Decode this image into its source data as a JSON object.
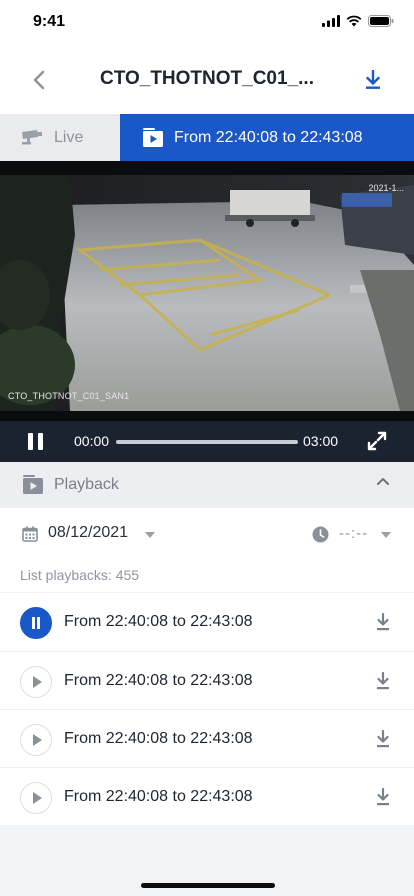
{
  "status_bar": {
    "time": "9:41"
  },
  "nav": {
    "title": "CTO_THOTNOT_C01_..."
  },
  "tabs": [
    {
      "label": "Live",
      "active": false
    },
    {
      "label": "From 22:40:08 to 22:43:08",
      "active": true
    }
  ],
  "video": {
    "camera_label": "CTO_THOTNOT_C01_SAN1",
    "timestamp_overlay": "2021-1..."
  },
  "player": {
    "current_time": "00:00",
    "duration": "03:00",
    "progress_fraction": 0.0,
    "state": "playing"
  },
  "playback_section": {
    "title": "Playback"
  },
  "filters": {
    "date": "08/12/2021",
    "time": "--:--"
  },
  "list_count_text": "List playbacks: 455",
  "playbacks": [
    {
      "label": "From 22:40:08 to 22:43:08",
      "playing": true
    },
    {
      "label": "From 22:40:08 to 22:43:08",
      "playing": false
    },
    {
      "label": "From 22:40:08 to 22:43:08",
      "playing": false
    },
    {
      "label": "From 22:40:08 to 22:43:08",
      "playing": false
    }
  ],
  "colors": {
    "accent": "#1a57c9",
    "control_bar": "#1b2230",
    "muted_text": "#8d929b"
  }
}
